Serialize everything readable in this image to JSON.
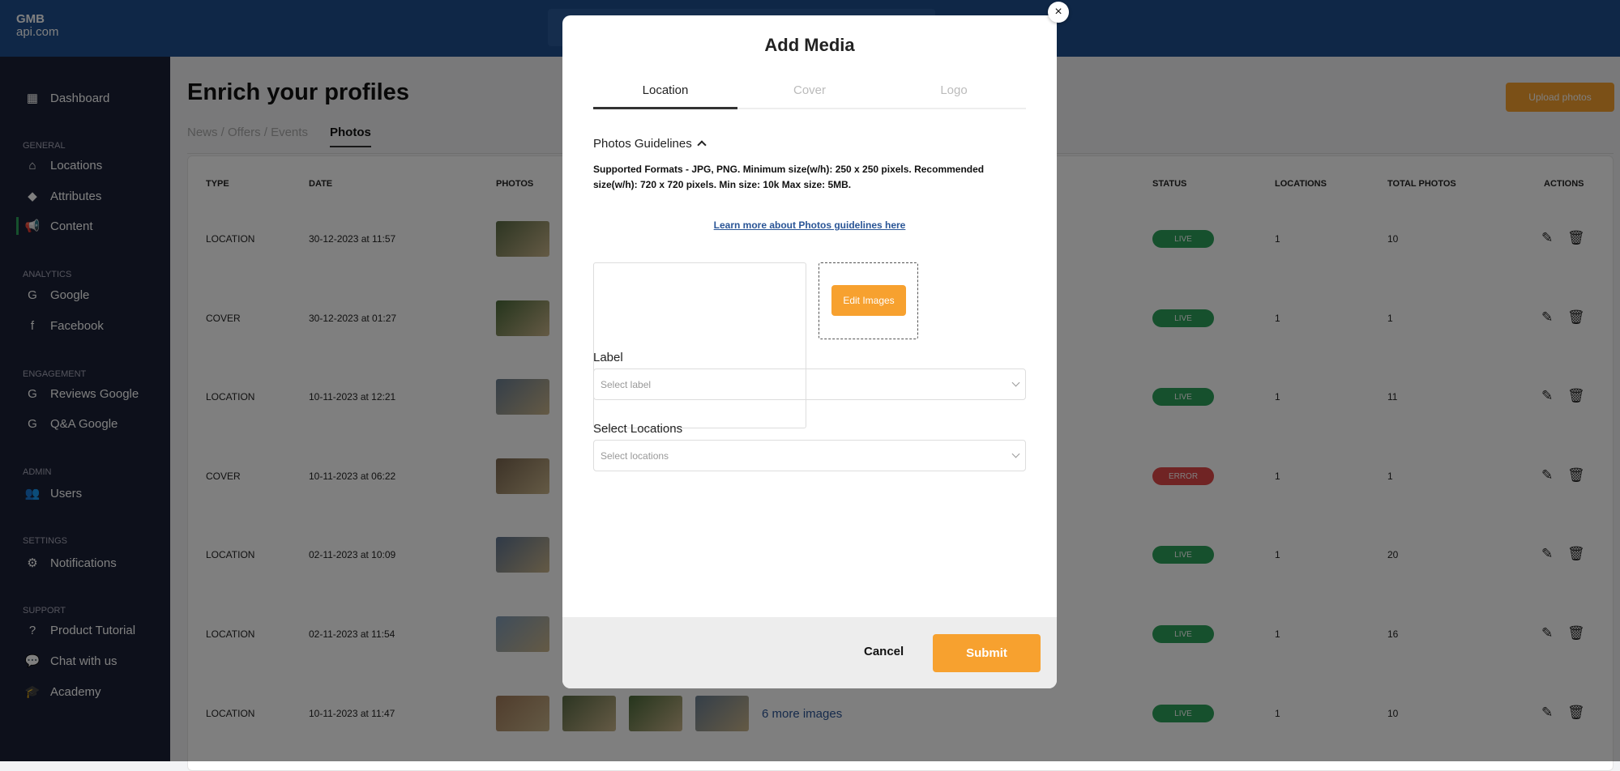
{
  "logo": {
    "line1": "GMB",
    "line2": "api.com"
  },
  "sidebar": {
    "dashboard": "Dashboard",
    "sections": [
      {
        "title": "GENERAL",
        "items": [
          "Locations",
          "Attributes",
          "Content"
        ]
      },
      {
        "title": "ANALYTICS",
        "items": [
          "Google",
          "Facebook"
        ]
      },
      {
        "title": "ENGAGEMENT",
        "items": [
          "Reviews Google",
          "Q&A Google"
        ]
      },
      {
        "title": "ADMIN",
        "items": [
          "Users"
        ]
      },
      {
        "title": "SETTINGS",
        "items": [
          "Notifications"
        ]
      },
      {
        "title": "SUPPORT",
        "items": [
          "Product Tutorial",
          "Chat with us",
          "Academy"
        ]
      }
    ],
    "active": "Content"
  },
  "page": {
    "title": "Enrich your profiles",
    "tabs": [
      "News / Offers / Events",
      "Photos"
    ],
    "active_tab": "Photos",
    "upload_label": "Upload photos"
  },
  "table": {
    "headers": [
      "TYPE",
      "DATE",
      "PHOTOS",
      "STATUS",
      "LOCATIONS",
      "TOTAL PHOTOS",
      "ACTIONS"
    ],
    "rows": [
      {
        "type": "LOCATION",
        "date": "30-12-2023 at 11:57",
        "status": "LIVE",
        "locations": "1",
        "total": "10"
      },
      {
        "type": "COVER",
        "date": "30-12-2023 at 01:27",
        "status": "LIVE",
        "locations": "1",
        "total": "1"
      },
      {
        "type": "LOCATION",
        "date": "10-11-2023 at 12:21",
        "status": "LIVE",
        "locations": "1",
        "total": "11"
      },
      {
        "type": "COVER",
        "date": "10-11-2023 at 06:22",
        "status": "ERROR",
        "locations": "1",
        "total": "1"
      },
      {
        "type": "LOCATION",
        "date": "02-11-2023 at 10:09",
        "status": "LIVE",
        "locations": "1",
        "total": "20"
      },
      {
        "type": "LOCATION",
        "date": "02-11-2023 at 11:54",
        "status": "LIVE",
        "locations": "1",
        "total": "16"
      },
      {
        "type": "LOCATION",
        "date": "10-11-2023 at 11:47",
        "status": "LIVE",
        "locations": "1",
        "total": "10",
        "more": "6 more images"
      }
    ],
    "status_colors": {
      "LIVE": "#2ca05a",
      "ERROR": "#e04848"
    }
  },
  "modal": {
    "title": "Add Media",
    "tabs": [
      "Location",
      "Cover",
      "Logo"
    ],
    "active_tab": "Location",
    "guidelines_toggle": "Photos Guidelines",
    "guidelines_text": "Supported Formats - JPG, PNG. Minimum size(w/h): 250 x 250 pixels. Recommended size(w/h): 720 x 720 pixels. Min size: 10k Max size: 5MB.",
    "learn_more": "Learn more about Photos guidelines here",
    "edit_images": "Edit Images",
    "label_title": "Label",
    "label_placeholder": "Select label",
    "locations_title": "Select Locations",
    "locations_placeholder": "Select locations",
    "cancel": "Cancel",
    "submit": "Submit",
    "close": "×"
  },
  "colors": {
    "accent": "#f7a12f",
    "header": "#1f4f8f",
    "sidebar": "#1a2137"
  }
}
